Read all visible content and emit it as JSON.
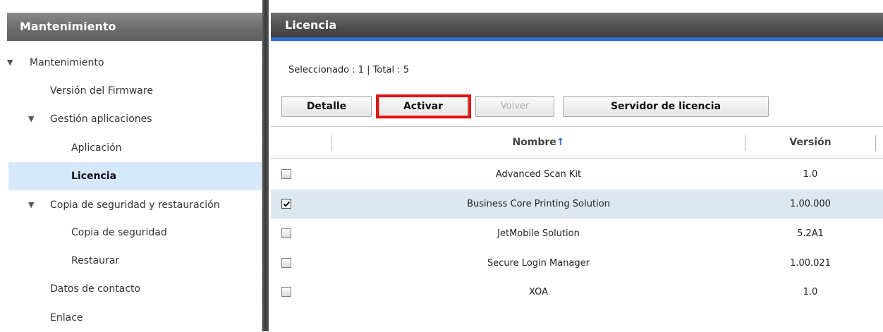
{
  "sidebar": {
    "title": "Mantenimiento",
    "items": [
      {
        "label": "Mantenimiento"
      },
      {
        "label": "Versión del Firmware"
      },
      {
        "label": "Gestión aplicaciones"
      },
      {
        "label": "Aplicación"
      },
      {
        "label": "Licencia"
      },
      {
        "label": "Copia de seguridad y restauración"
      },
      {
        "label": "Copia de seguridad"
      },
      {
        "label": "Restaurar"
      },
      {
        "label": "Datos de contacto"
      },
      {
        "label": "Enlace"
      }
    ],
    "arrow_glyph": "▼"
  },
  "main": {
    "title": "Licencia",
    "status": "Seleccionado : 1 | Total : 5",
    "buttons": {
      "detail": "Detalle",
      "activate": "Activar",
      "back": "Volver",
      "license_server": "Servidor de licencia"
    },
    "table": {
      "columns": {
        "name": "Nombre",
        "sort_glyph": "↑",
        "version": "Versión"
      },
      "rows": [
        {
          "name": "Advanced Scan Kit",
          "version": "1.0",
          "checked": false
        },
        {
          "name": "Business Core Printing Solution",
          "version": "1.00.000",
          "checked": true
        },
        {
          "name": "JetMobile Solution",
          "version": "5.2A1",
          "checked": false
        },
        {
          "name": "Secure Login Manager",
          "version": "1.00.021",
          "checked": false
        },
        {
          "name": "XOA",
          "version": "1.0",
          "checked": false
        }
      ]
    }
  },
  "colors": {
    "highlight": "#e01010",
    "selected_sidebar": "#d6e9fb",
    "selected_row": "#dde7ef",
    "header_accent": "#2d6fd0"
  }
}
